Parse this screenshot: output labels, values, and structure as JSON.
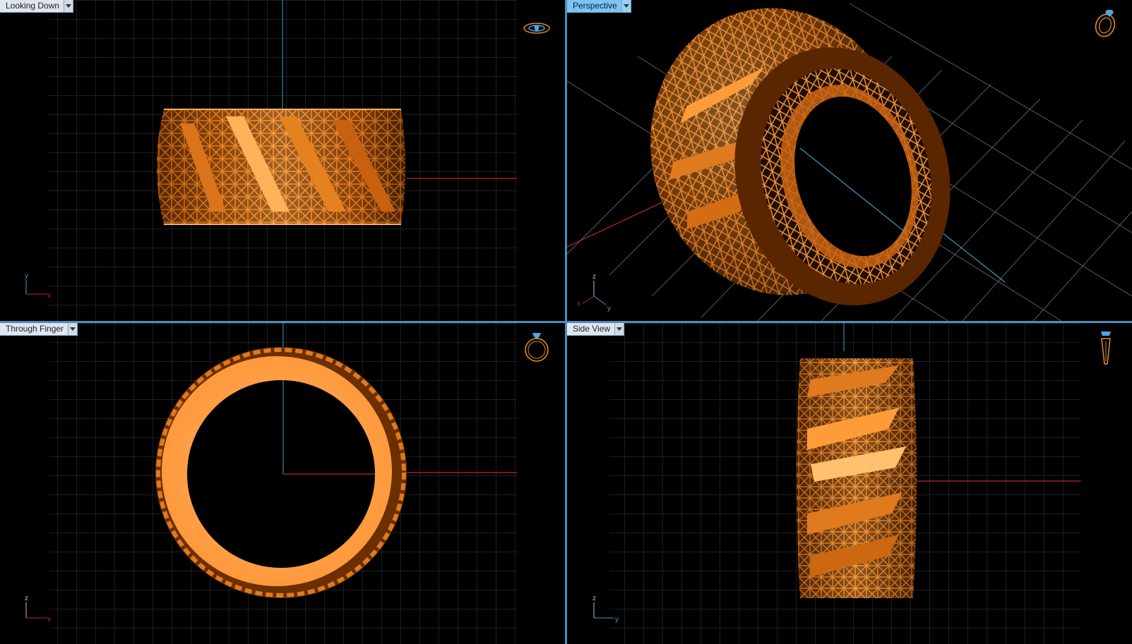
{
  "viewports": {
    "top": {
      "label": "Looking Down",
      "active": false,
      "icon": "ring-top-view-icon",
      "axis_v": "y",
      "axis_h": "x"
    },
    "perspective": {
      "label": "Perspective",
      "active": true,
      "icon": "ring-perspective-icon",
      "axis_v": "z",
      "axis_x": "x",
      "axis_y": "y"
    },
    "front": {
      "label": "Through Finger",
      "active": false,
      "icon": "ring-front-view-icon",
      "axis_v": "z",
      "axis_h": "x"
    },
    "side": {
      "label": "Side View",
      "active": false,
      "icon": "ring-side-view-icon",
      "axis_v": "z",
      "axis_h": "y"
    }
  },
  "colors": {
    "background": "#000000",
    "grid": "#3a3a3a",
    "grid_major": "#5a5a5a",
    "axis_x": "#c0281e",
    "axis_y": "#3aa0c8",
    "accent": "#7cc4f2",
    "metal": "#e07a1e",
    "metal_light": "#ffb060",
    "metal_dark": "#6b2f00"
  }
}
